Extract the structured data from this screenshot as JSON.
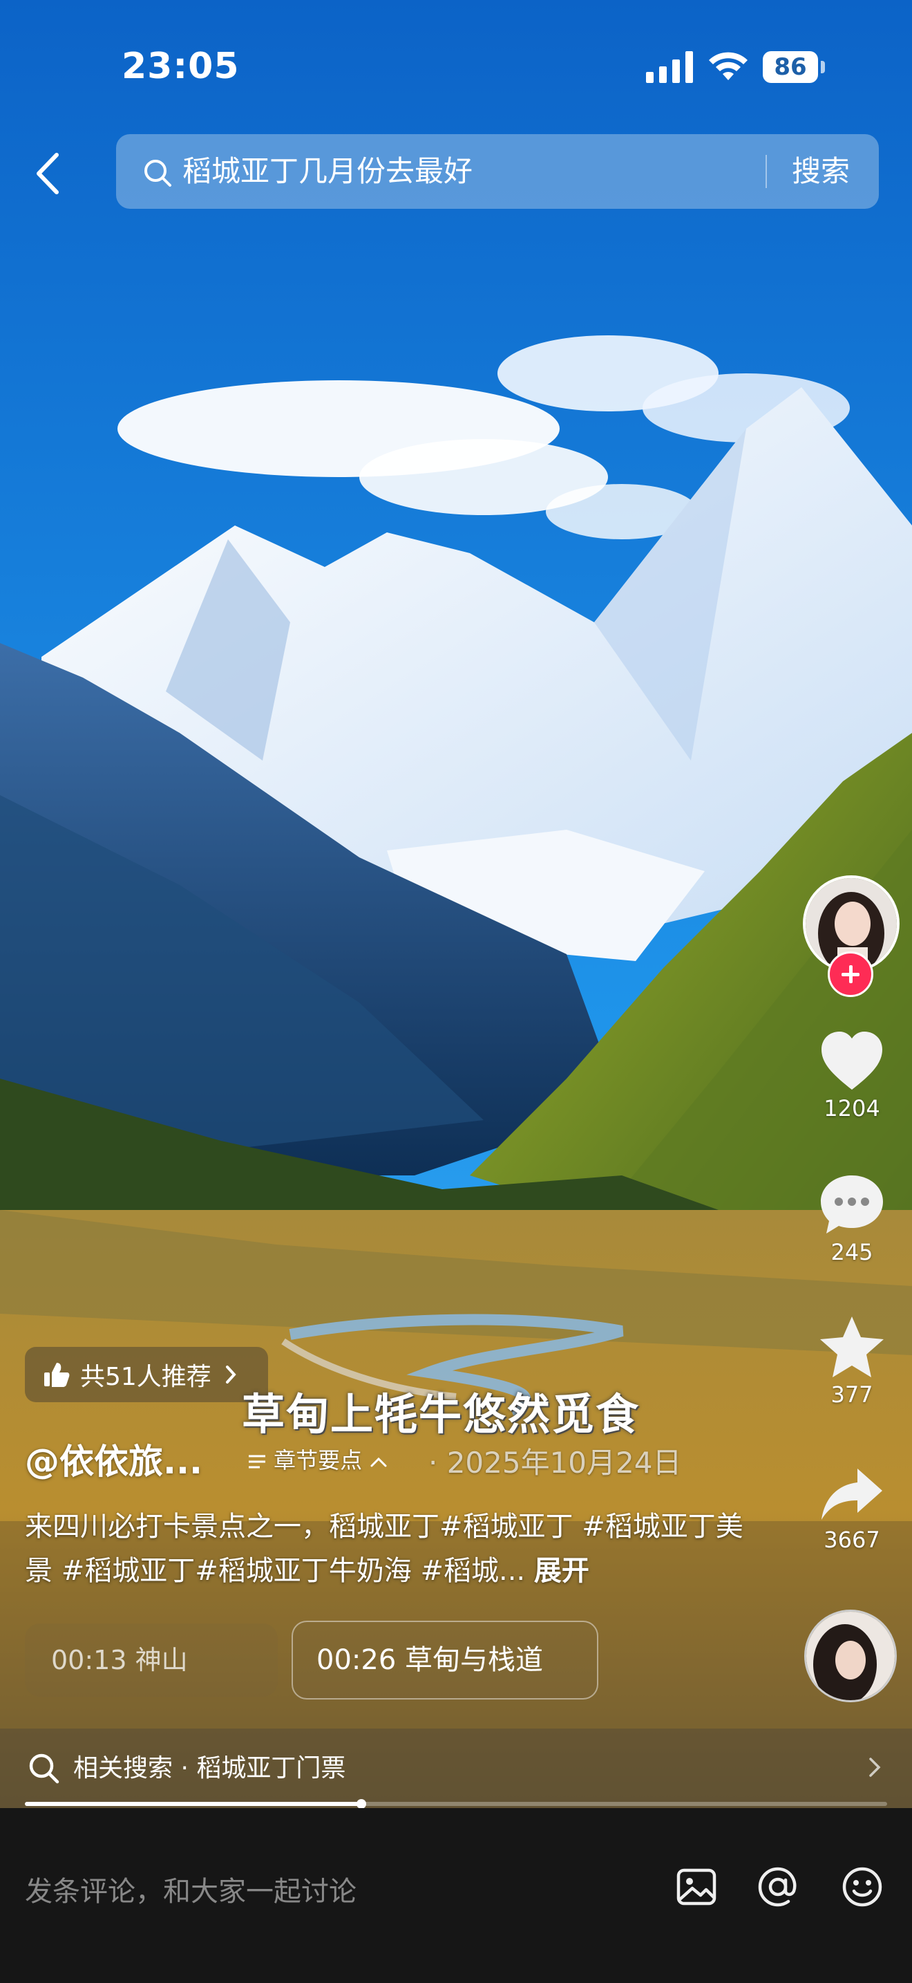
{
  "status_bar": {
    "time": "23:05",
    "battery": "86"
  },
  "search": {
    "query": "稻城亚丁几月份去最好",
    "button": "搜索"
  },
  "rail": {
    "likes": "1204",
    "comments": "245",
    "favorites": "377",
    "shares": "3667"
  },
  "video": {
    "recommend_pill": "共51人推荐",
    "caption": "草甸上牦牛悠然觅食",
    "author": "@依依旅...",
    "chapters_label": "章节要点",
    "date": "· 2025年10月24日",
    "description": "来四川必打卡景点之一，稻城亚丁#稻城亚丁 #稻城亚丁美景 #稻城亚丁#稻城亚丁牛奶海 #稻城...",
    "expand": "展开",
    "chapter_items": [
      "00:13 神山",
      "00:26 草甸与栈道"
    ],
    "progress": 0.39
  },
  "related": {
    "label": "相关搜索 · 稻城亚丁门票"
  },
  "comment_bar": {
    "placeholder": "发条评论，和大家一起讨论"
  },
  "colors": {
    "follow": "#fe2c55",
    "sky": "#1a86e0",
    "bottom_bar": "#161616"
  },
  "icons": [
    "back-icon",
    "search-icon",
    "heart-icon",
    "comment-icon",
    "star-icon",
    "share-icon",
    "thumbs-up-icon",
    "image-icon",
    "at-icon",
    "emoji-icon",
    "chevron-right-icon"
  ]
}
